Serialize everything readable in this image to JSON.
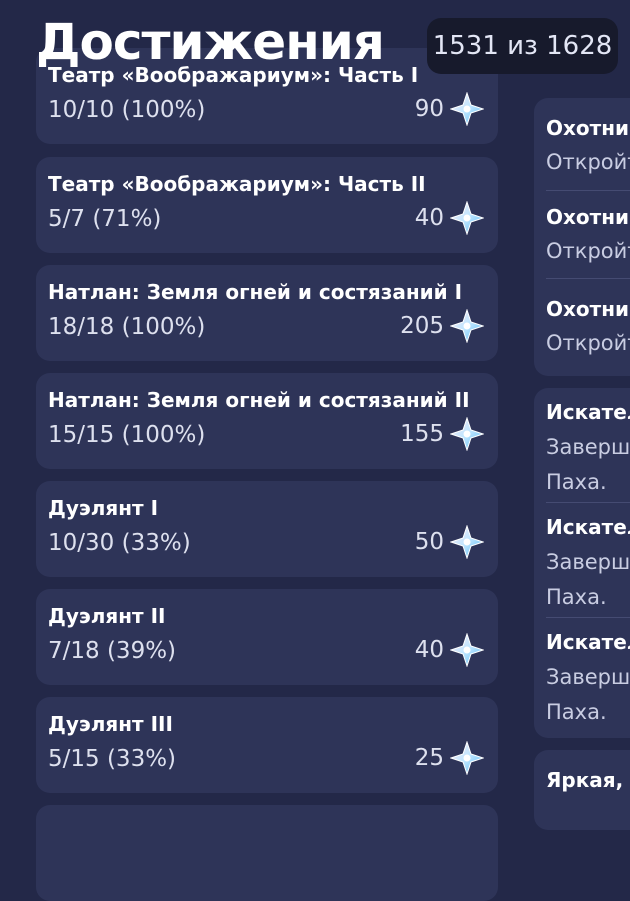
{
  "header": {
    "title": "Достижения",
    "count": "1531 из 1628"
  },
  "categories": [
    {
      "name": "Театр «Воображариум»: Часть I",
      "progress": "10/10 (100%)",
      "reward": "90"
    },
    {
      "name": "Театр «Воображариум»: Часть II",
      "progress": "5/7 (71%)",
      "reward": "40"
    },
    {
      "name": "Натлан: Земля огней и состязаний I",
      "progress": "18/18 (100%)",
      "reward": "205"
    },
    {
      "name": "Натлан: Земля огней и состязаний II",
      "progress": "15/15 (100%)",
      "reward": "155"
    },
    {
      "name": "Дуэлянт I",
      "progress": "10/30 (33%)",
      "reward": "50"
    },
    {
      "name": "Дуэлянт II",
      "progress": "7/18 (39%)",
      "reward": "40"
    },
    {
      "name": "Дуэлянт III",
      "progress": "5/15 (33%)",
      "reward": "25"
    }
  ],
  "right_panel": {
    "group1": [
      {
        "title": "Охотни",
        "desc": "Откройт"
      },
      {
        "title": "Охотни",
        "desc": "Откройт"
      },
      {
        "title": "Охотни",
        "desc": "Откройт"
      }
    ],
    "group2": [
      {
        "title": "Искател",
        "desc1": "Заверш",
        "desc2": "Паха."
      },
      {
        "title": "Искател",
        "desc1": "Заверш",
        "desc2": "Паха."
      },
      {
        "title": "Искател",
        "desc1": "Заверш",
        "desc2": "Паха."
      }
    ],
    "group3": [
      {
        "title": "Яркая,"
      }
    ]
  },
  "icons": {
    "reward": "primogem-icon"
  },
  "colors": {
    "background": "#232848",
    "card": "#2e3458",
    "badge": "#171a2c"
  }
}
